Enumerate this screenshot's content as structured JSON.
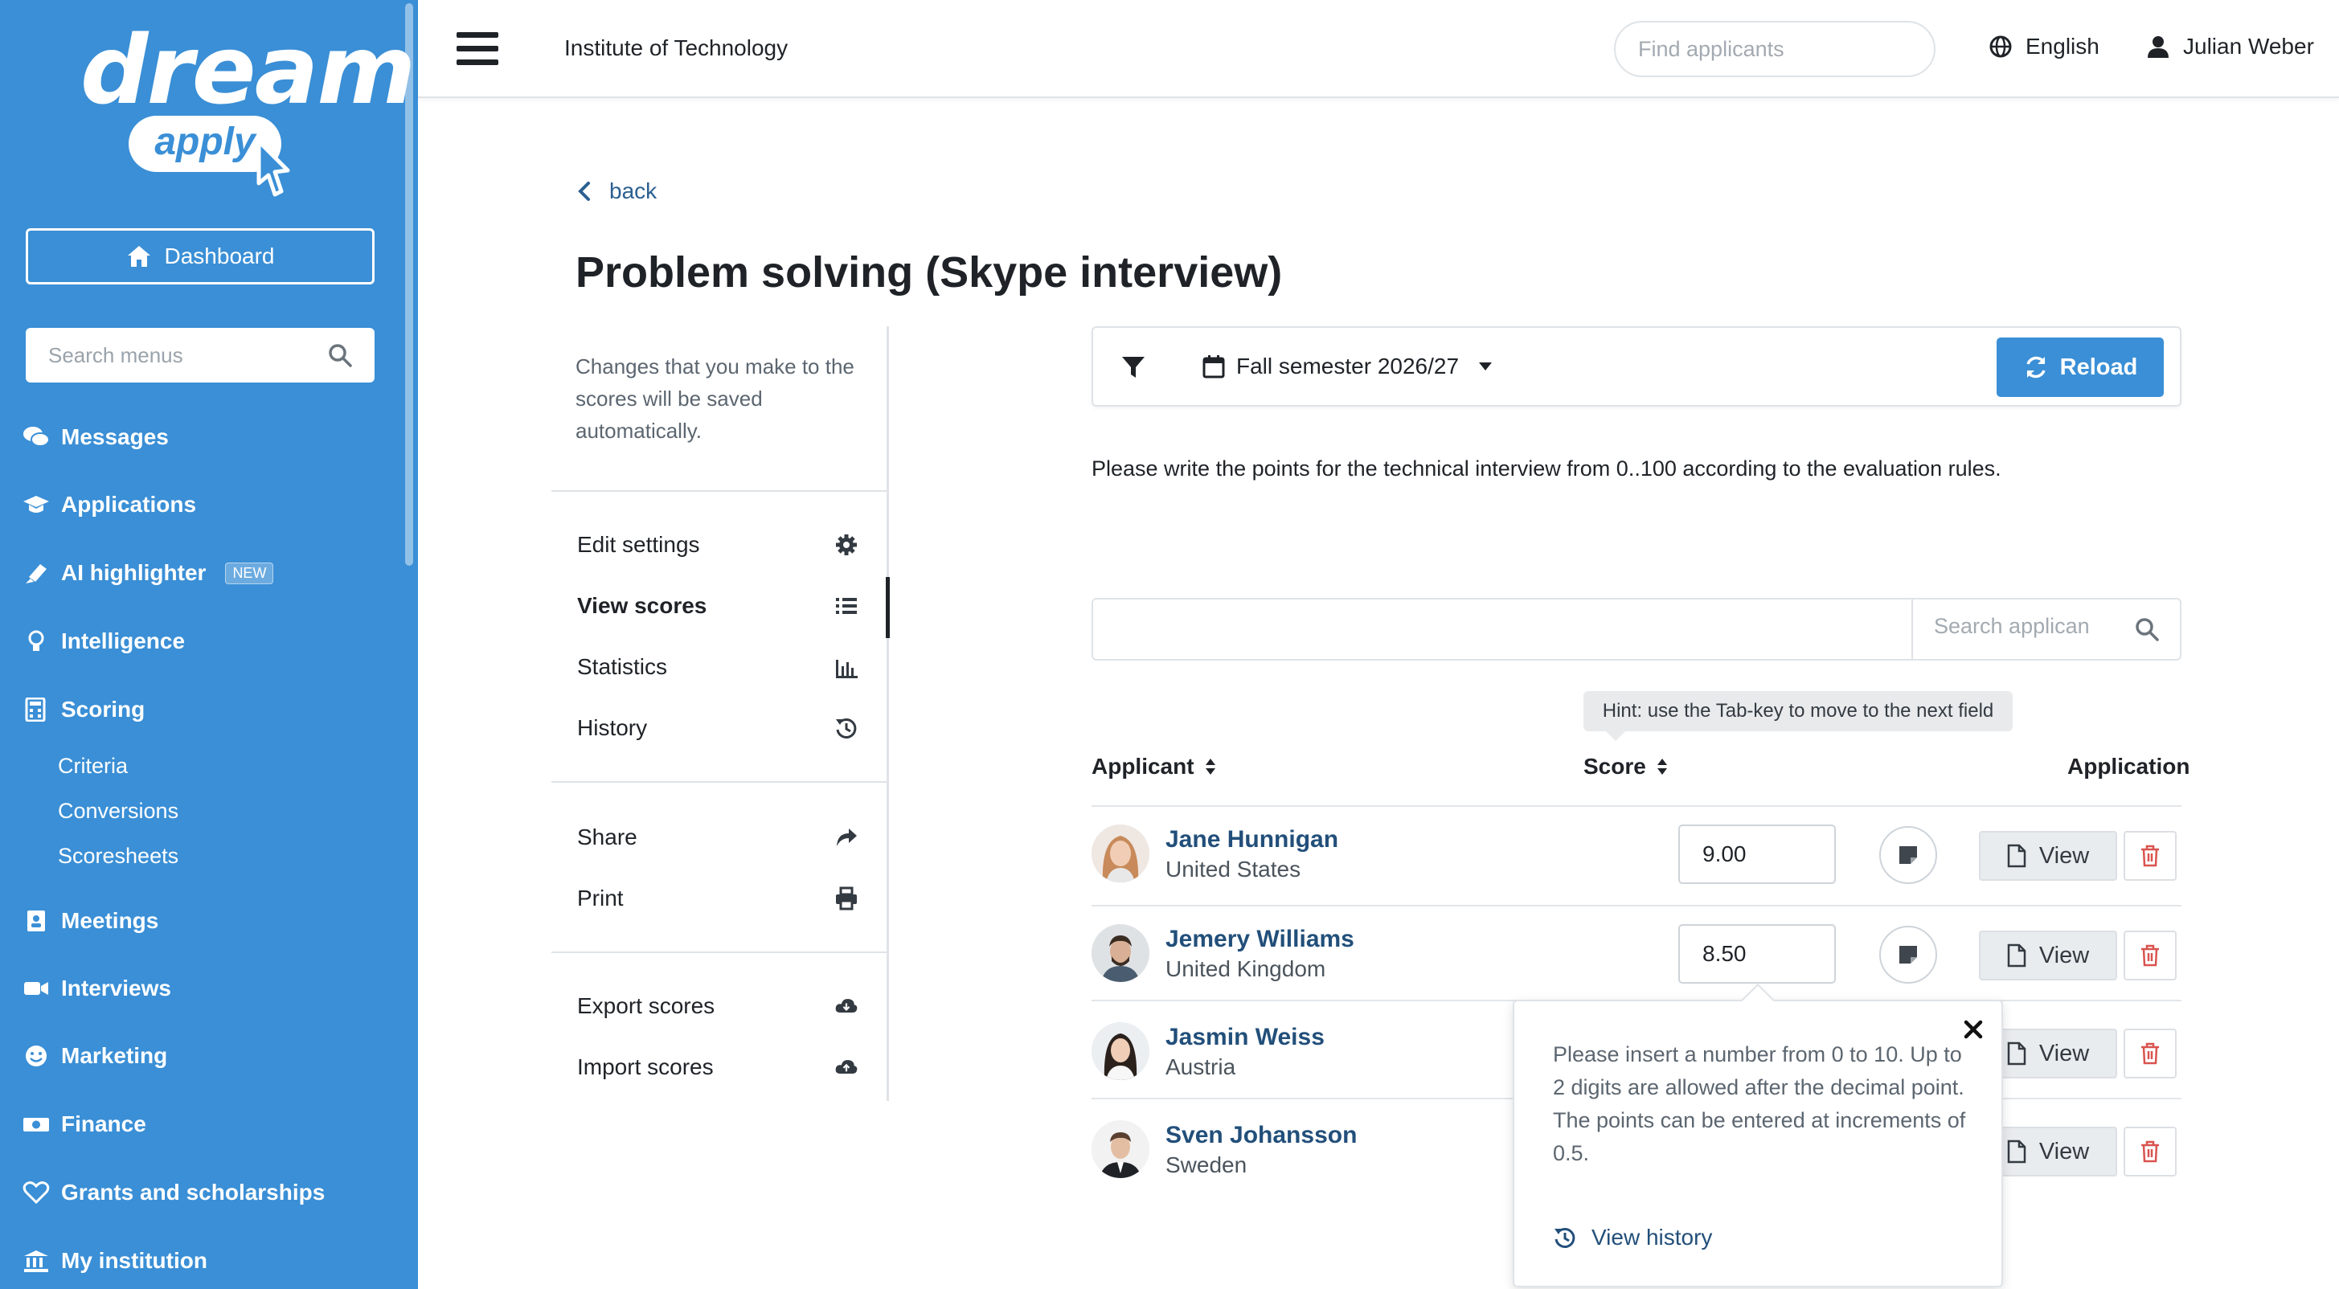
{
  "brand": {
    "word": "dream",
    "sub": "apply"
  },
  "sidebar": {
    "dashboard_label": "Dashboard",
    "search_placeholder": "Search menus",
    "items": [
      {
        "label": "Messages",
        "icon": "comments-icon"
      },
      {
        "label": "Applications",
        "icon": "graduation-cap-icon"
      },
      {
        "label": "AI highlighter",
        "icon": "highlighter-icon",
        "badge": "NEW"
      },
      {
        "label": "Intelligence",
        "icon": "lightbulb-icon"
      },
      {
        "label": "Scoring",
        "icon": "calculator-icon"
      },
      {
        "label": "Meetings",
        "icon": "calendar-user-icon"
      },
      {
        "label": "Interviews",
        "icon": "video-camera-icon"
      },
      {
        "label": "Marketing",
        "icon": "smile-icon"
      },
      {
        "label": "Finance",
        "icon": "money-bill-icon"
      },
      {
        "label": "Grants and scholarships",
        "icon": "heart-icon"
      },
      {
        "label": "My institution",
        "icon": "university-icon"
      }
    ],
    "scoring_sub": [
      "Criteria",
      "Conversions",
      "Scoresheets"
    ]
  },
  "header": {
    "institution": "Institute of Technology",
    "search_placeholder": "Find applicants",
    "language": "English",
    "user": "Julian Weber"
  },
  "page": {
    "back_label": "back",
    "title": "Problem solving (Skype interview)",
    "note": "Changes that you make to the scores will be saved automatically.",
    "menu": [
      {
        "label": "Edit settings",
        "icon": "gear-icon"
      },
      {
        "label": "View scores",
        "icon": "list-icon",
        "active": true
      },
      {
        "label": "Statistics",
        "icon": "bar-chart-icon"
      },
      {
        "label": "History",
        "icon": "history-icon"
      },
      {
        "label": "Share",
        "icon": "share-icon"
      },
      {
        "label": "Print",
        "icon": "print-icon"
      },
      {
        "label": "Export scores",
        "icon": "cloud-download-icon"
      },
      {
        "label": "Import scores",
        "icon": "cloud-upload-icon"
      }
    ],
    "filter": {
      "semester": "Fall semester 2026/27",
      "reload_label": "Reload"
    },
    "instructions": "Please write the points for the technical interview from 0..100 according to the evaluation rules.",
    "table_search_placeholder": "Search applican",
    "hint": "Hint: use the Tab-key to move to the next field",
    "columns": {
      "applicant": "Applicant",
      "score": "Score",
      "application": "Application"
    },
    "view_label": "View",
    "applicants": [
      {
        "name": "Jane Hunnigan",
        "country": "United States",
        "score": "9.00"
      },
      {
        "name": "Jemery Williams",
        "country": "United Kingdom",
        "score": "8.50"
      },
      {
        "name": "Jasmin Weiss",
        "country": "Austria",
        "score": ""
      },
      {
        "name": "Sven Johansson",
        "country": "Sweden",
        "score": ""
      }
    ],
    "popover": {
      "text": "Please insert a number from 0 to 10. Up to 2 digits are allowed after the decimal point. The points can be entered at increments of 0.5.",
      "history_label": "View history"
    }
  },
  "colors": {
    "accent": "#3a8fd6",
    "link": "#224f7a",
    "danger": "#d9534f"
  }
}
